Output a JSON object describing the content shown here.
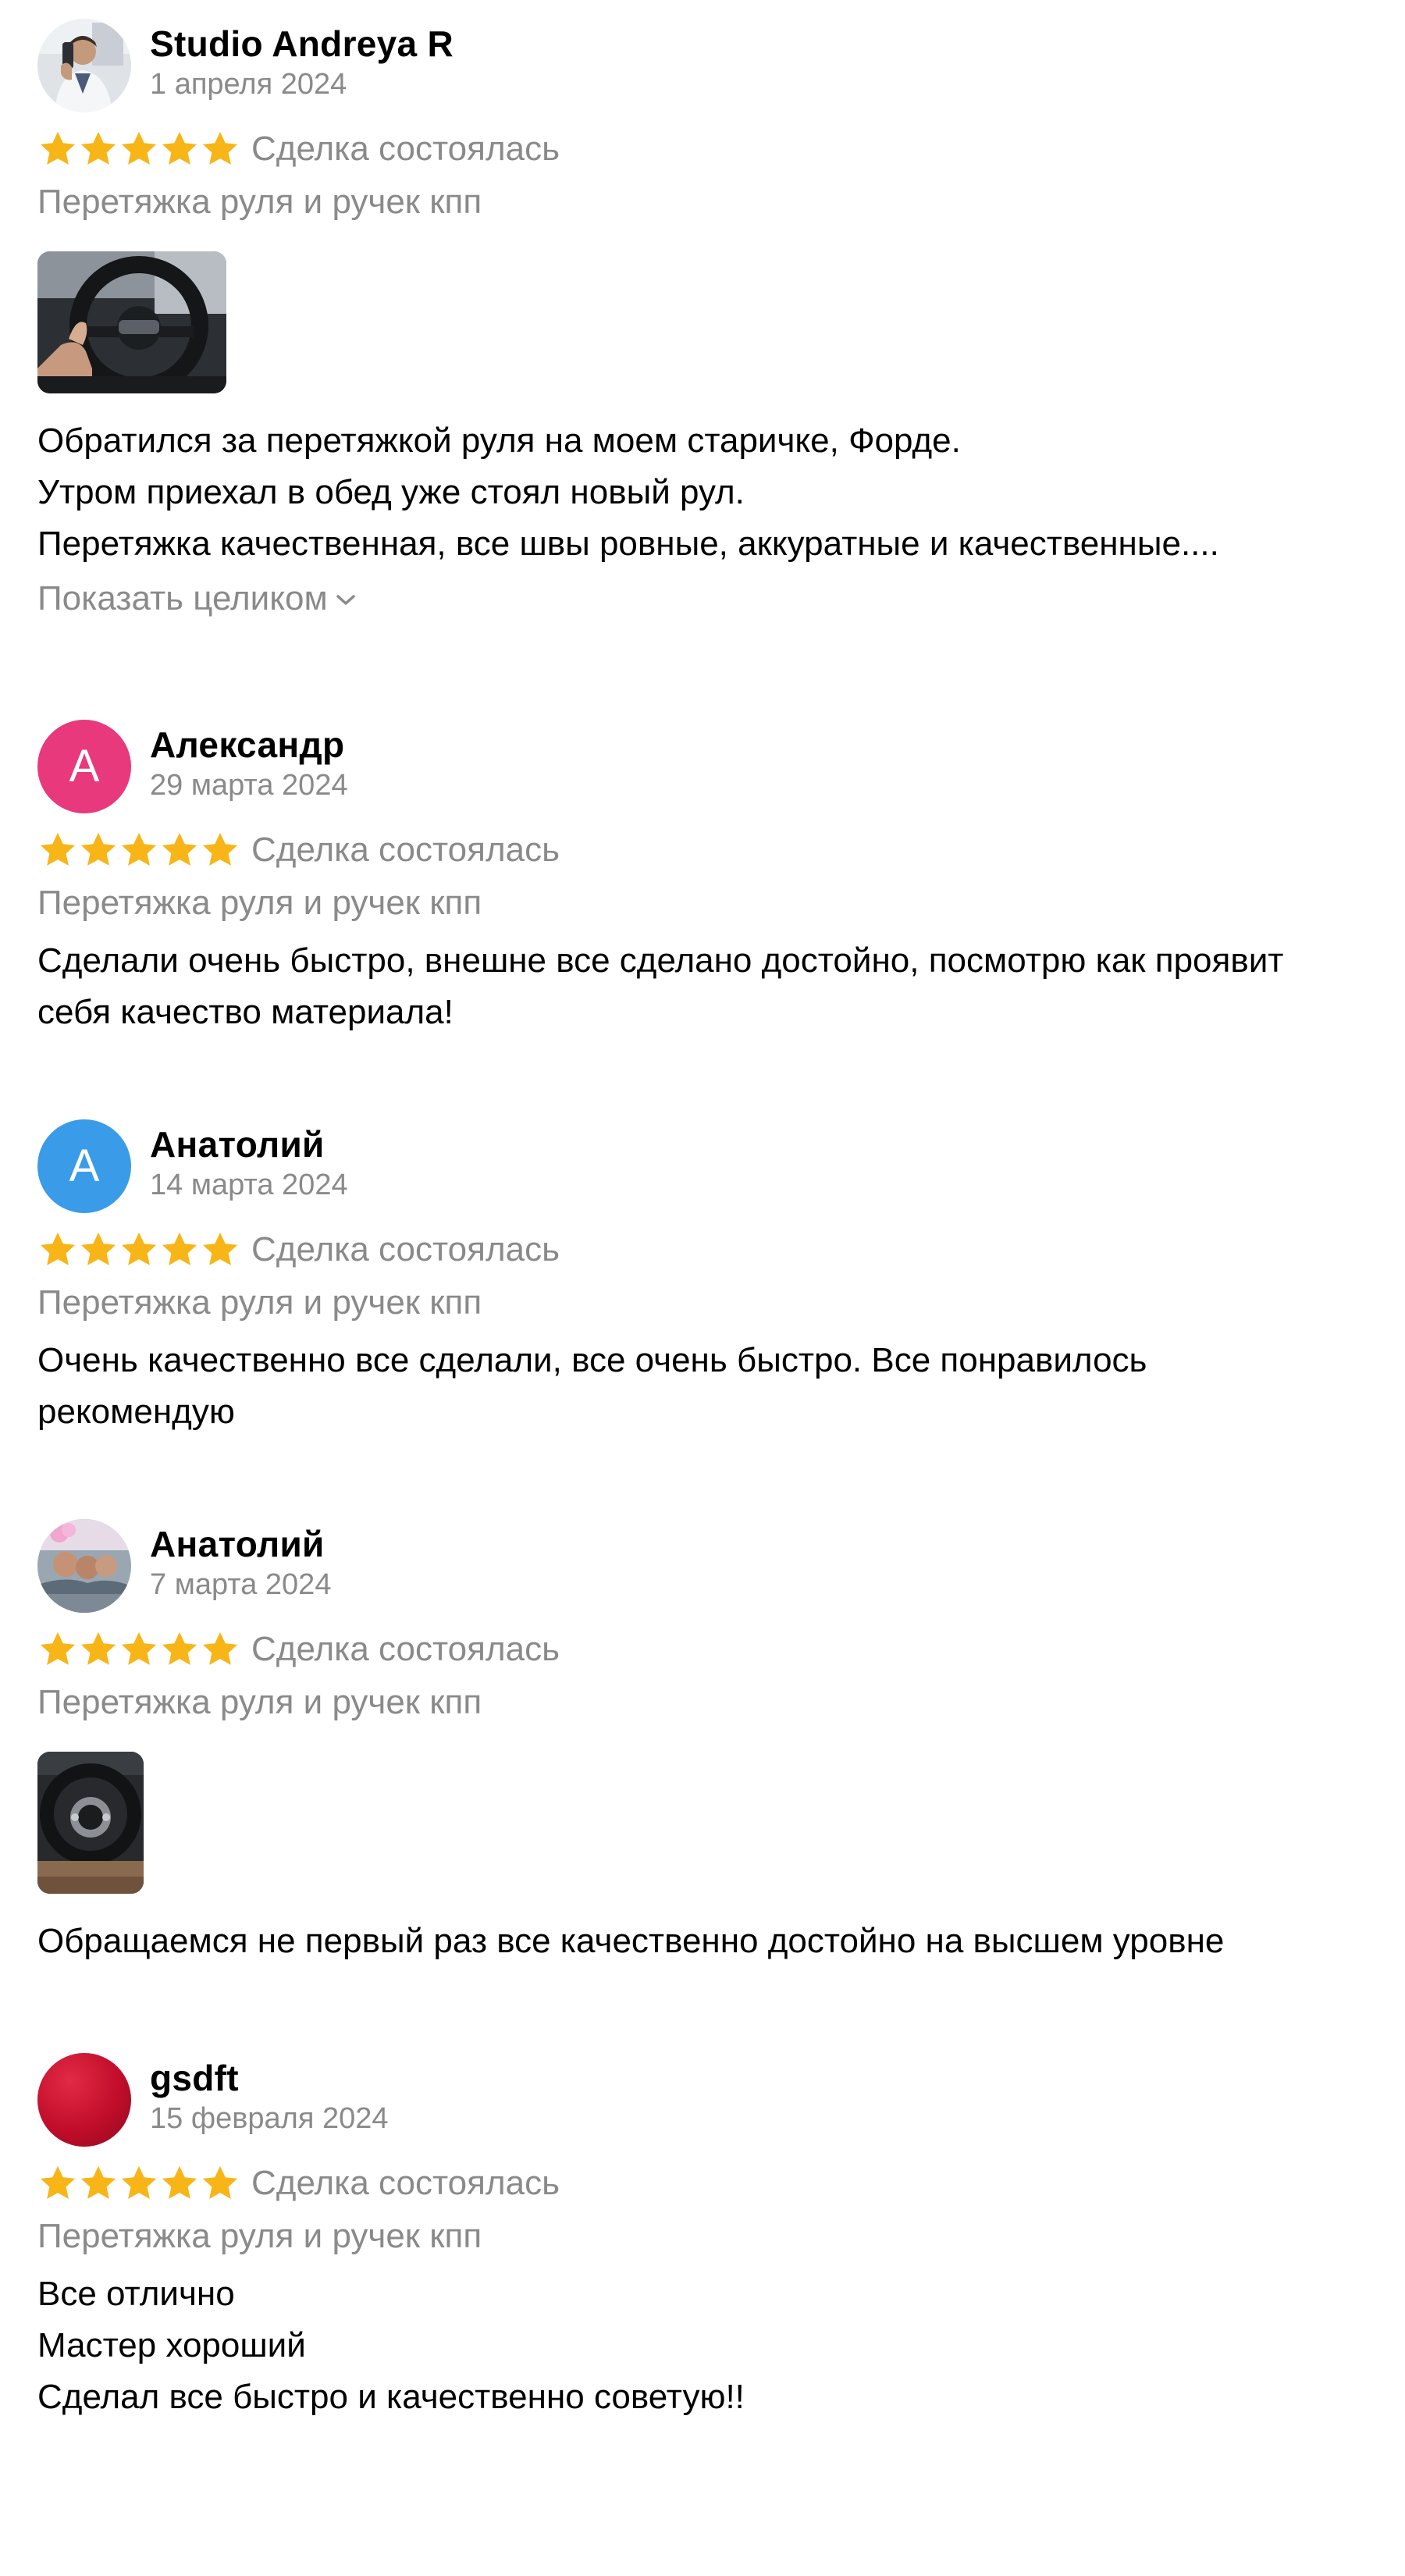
{
  "colors": {
    "star": "#f8b517",
    "muted_text": "#8a8a8a",
    "avatar_pink": "#e8397c",
    "avatar_blue": "#3a9be8",
    "avatar_red": "#c10d2a"
  },
  "reviews": [
    {
      "author": "Studio Andreya R",
      "date": "1 апреля 2024",
      "rating": 5,
      "deal_status": "Сделка состоялась",
      "service": "Перетяжка руля и ручек кпп",
      "avatar": "photo-portrait",
      "photo": "steering-wheel-photo",
      "text_lines": [
        "Обратился за перетяжкой руля на моем старичке, Форде.",
        "Утром приехал в обед уже стоял новый рул.",
        "Перетяжка качественная, все швы ровные, аккуратные и качественные...."
      ],
      "show_more": "Показать целиком"
    },
    {
      "author": "Александр",
      "date": "29 марта 2024",
      "rating": 5,
      "deal_status": "Сделка состоялась",
      "service": "Перетяжка руля и ручек кпп",
      "avatar_letter": "А",
      "text_lines": [
        "Сделали очень быстро, внешне все сделано достойно, посмотрю как проявит",
        "себя качество материала!"
      ]
    },
    {
      "author": "Анатолий",
      "date": "14 марта 2024",
      "rating": 5,
      "deal_status": "Сделка состоялась",
      "service": "Перетяжка руля и ручек кпп",
      "avatar_letter": "А",
      "text_lines": [
        "Очень качественно все сделали, все очень быстро. Все понравилось",
        "рекомендую"
      ]
    },
    {
      "author": "Анатолий",
      "date": "7 марта 2024",
      "rating": 5,
      "deal_status": "Сделка состоялась",
      "service": "Перетяжка руля и ручек кпп",
      "avatar": "photo-group",
      "photo": "steering-wheel-photo",
      "text_lines": [
        "Обращаемся не первый раз все качественно достойно на высшем уровне"
      ]
    },
    {
      "author": "gsdft",
      "date": "15 февраля 2024",
      "rating": 5,
      "deal_status": "Сделка состоялась",
      "service": "Перетяжка руля и ручек кпп",
      "avatar": "red-circle",
      "text_lines": [
        "Все отлично",
        "Мастер хороший",
        "Сделал все быстро и качественно советую!!"
      ]
    }
  ]
}
